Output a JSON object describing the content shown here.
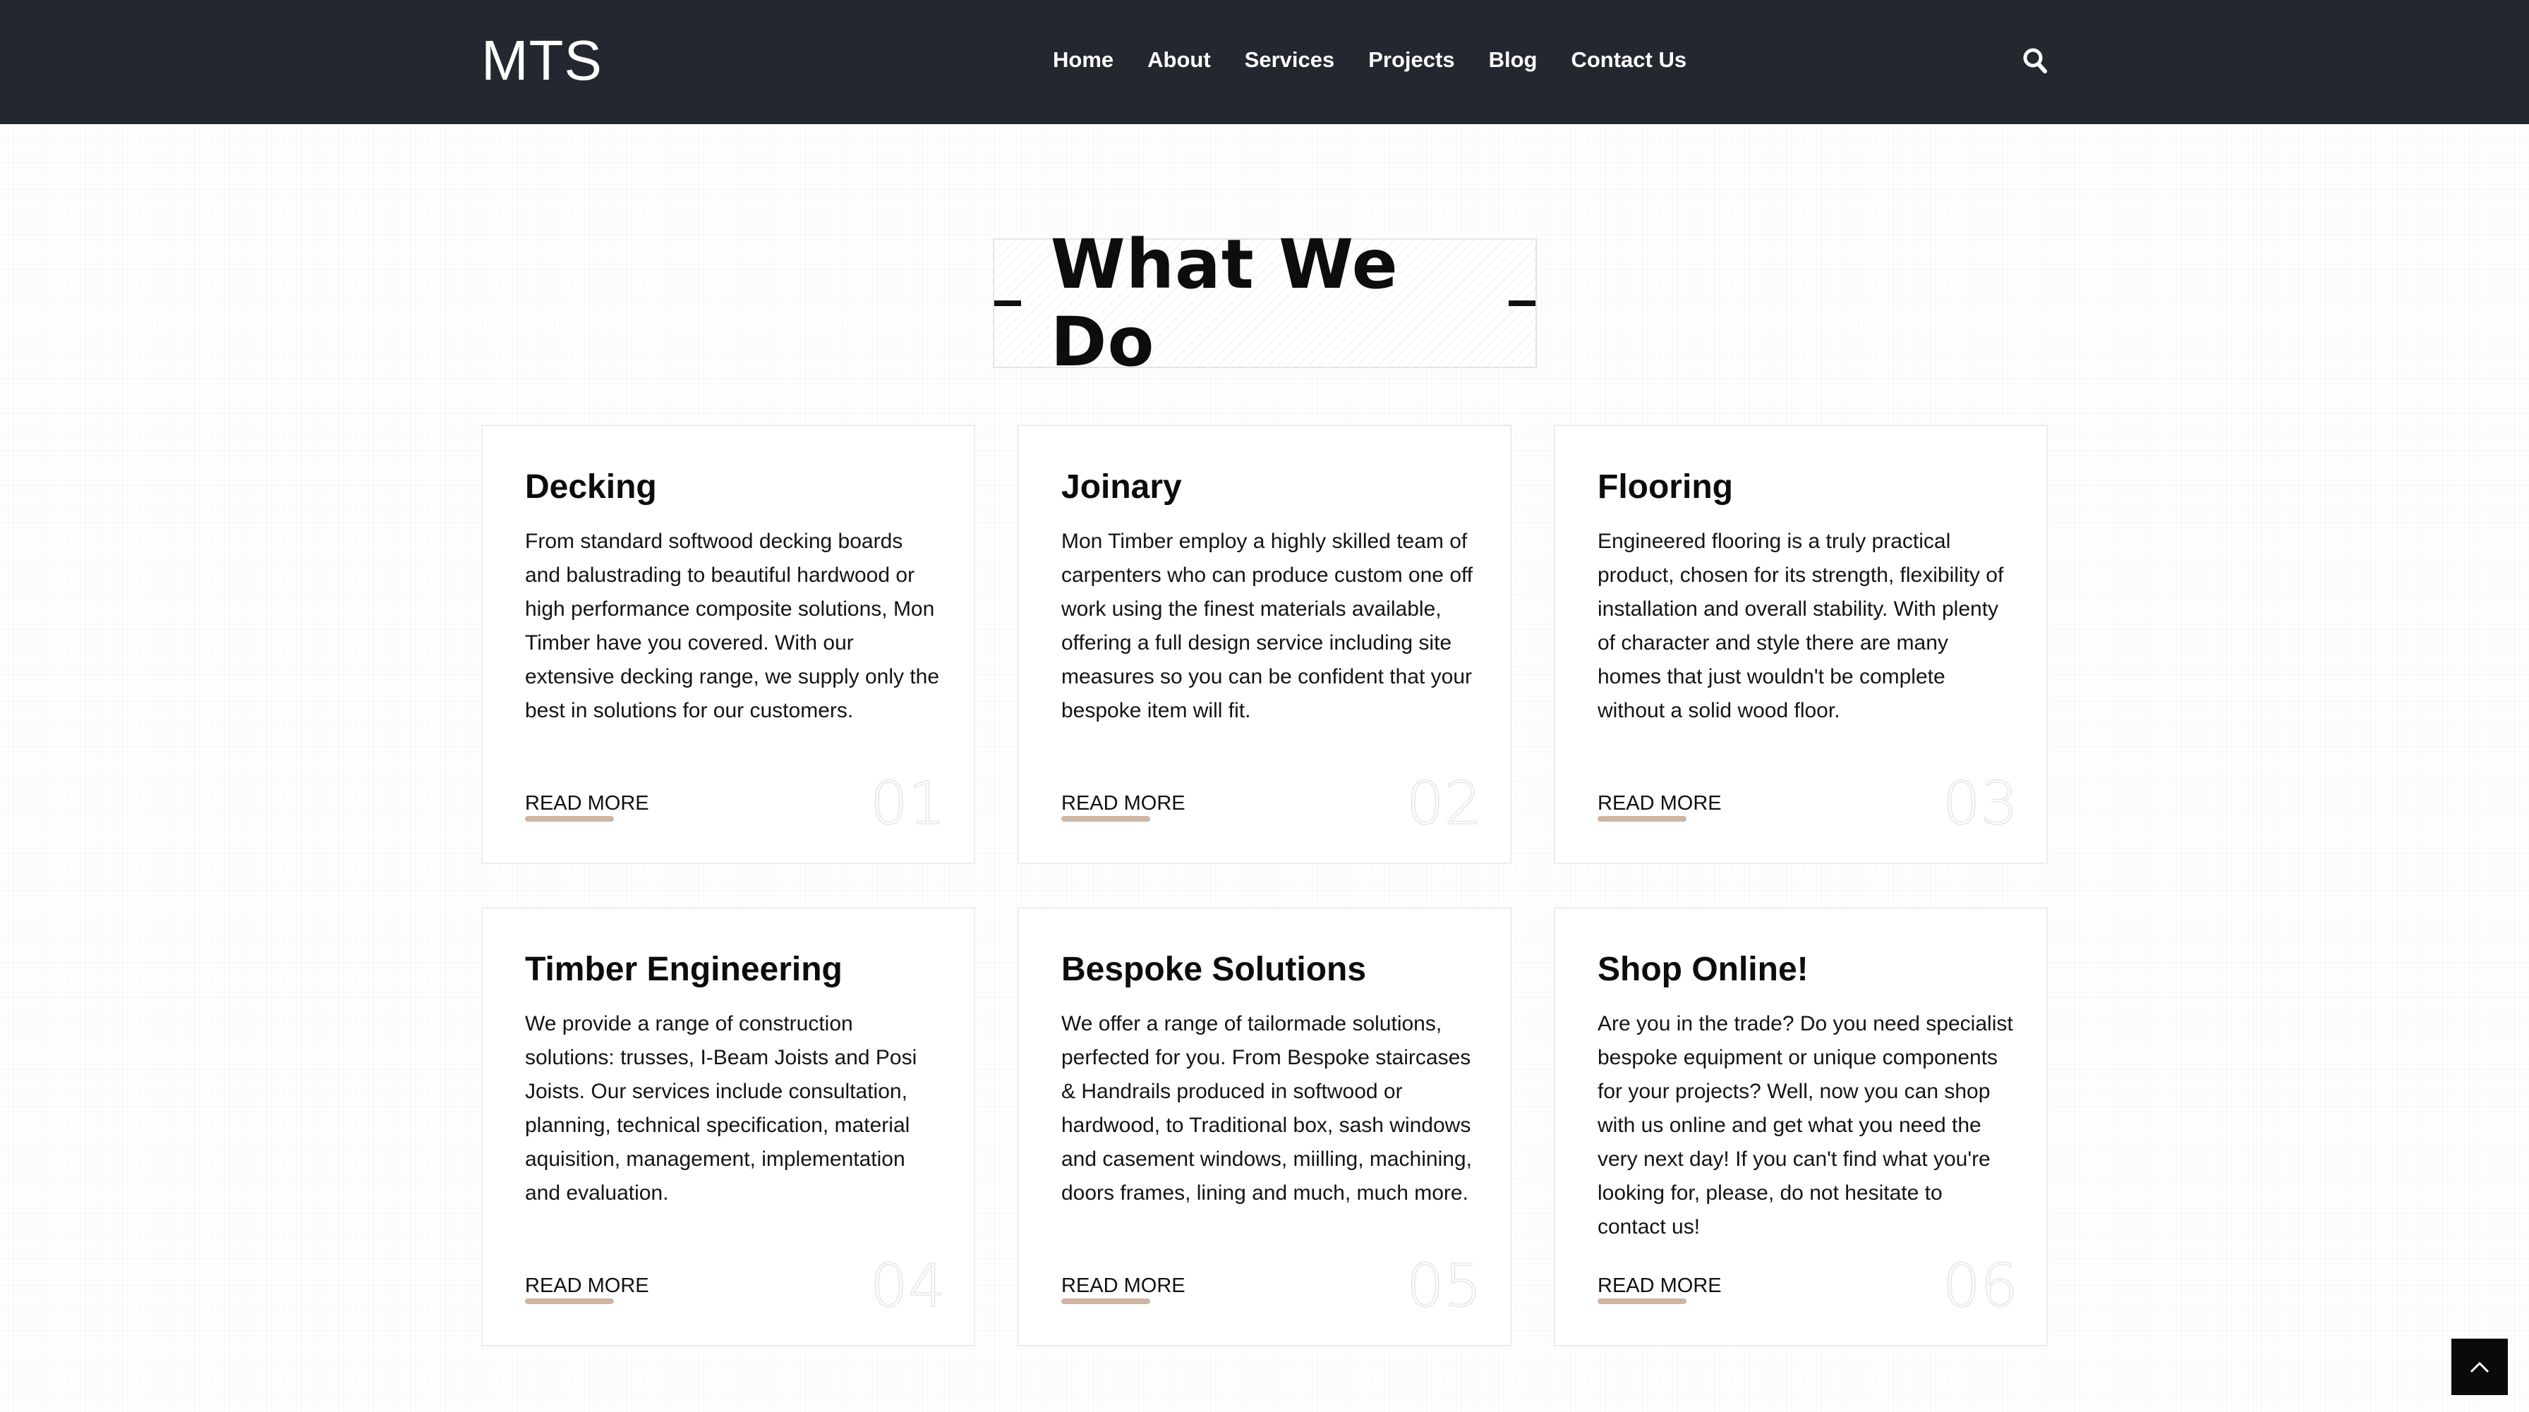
{
  "header": {
    "logo": "MTS",
    "nav": [
      "Home",
      "About",
      "Services",
      "Projects",
      "Blog",
      "Contact Us"
    ],
    "search_icon": "search-icon"
  },
  "section": {
    "title": "What We Do"
  },
  "cards": [
    {
      "title": "Decking",
      "text": "From standard softwood decking boards and balustrading to beautiful hardwood or high performance composite solutions, Mon Timber have you covered. With our extensive decking range, we supply only the best in solutions for our customers.",
      "link": "READ MORE",
      "number": "01"
    },
    {
      "title": "Joinary",
      "text": "Mon Timber employ a highly skilled team of carpenters who can produce custom one off work using the finest materials available, offering a full design service including site measures so you can be confident that your bespoke item will fit.",
      "link": "READ MORE",
      "number": "02"
    },
    {
      "title": "Flooring",
      "text": "Engineered flooring is a truly practical product, chosen for its strength, flexibility of installation and overall stability. With plenty of character and style there are many homes that just wouldn't be complete without a solid wood floor.",
      "link": "READ MORE",
      "number": "03"
    },
    {
      "title": "Timber Engineering",
      "text": "We provide a range of construction solutions: trusses, I-Beam Joists and Posi Joists. Our services include consultation, planning, technical specification, material aquisition, management, implementation and evaluation.",
      "link": "READ MORE",
      "number": "04"
    },
    {
      "title": "Bespoke Solutions",
      "text": "We offer a range of tailormade solutions, perfected for you. From Bespoke staircases & Handrails produced in softwood or hardwood, to Traditional box, sash windows and casement windows, miilling, machining, doors frames, lining and much, much more.",
      "link": "READ MORE",
      "number": "05"
    },
    {
      "title": "Shop Online!",
      "text": "Are you in the trade? Do you need specialist bespoke equipment or unique components for your projects? Well, now you can shop with us online and get what you need the very next day! If you can't find what you're looking for, please, do not hesitate to contact us!",
      "link": "READ MORE",
      "number": "06"
    }
  ],
  "back_to_top_icon": "chevron-up-icon",
  "colors": {
    "header_bg": "#232730",
    "accent_underline": "#c9ad99",
    "back_to_top_bg": "#0a0a0a"
  }
}
